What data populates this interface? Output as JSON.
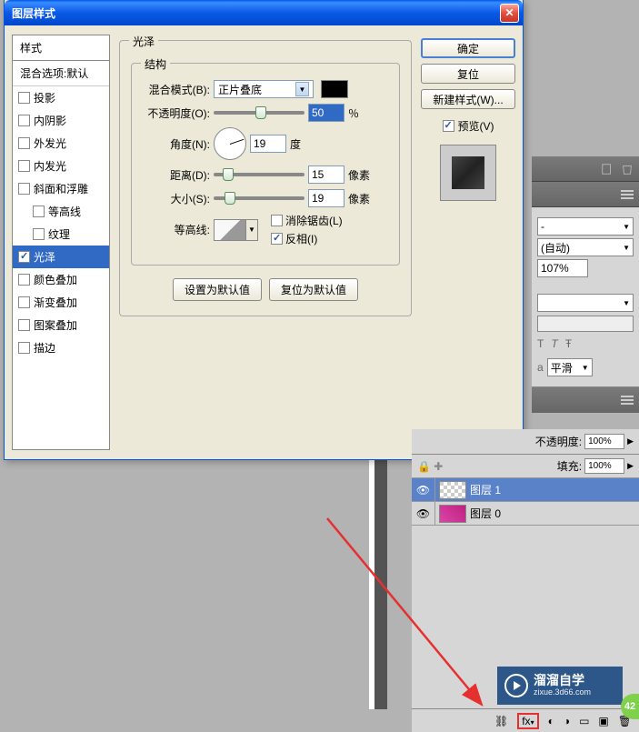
{
  "dialog": {
    "title": "图层样式",
    "styles_header": "样式",
    "blending_options": "混合选项:默认",
    "style_items": [
      {
        "label": "投影",
        "checked": false,
        "indent": false
      },
      {
        "label": "内阴影",
        "checked": false,
        "indent": false
      },
      {
        "label": "外发光",
        "checked": false,
        "indent": false
      },
      {
        "label": "内发光",
        "checked": false,
        "indent": false
      },
      {
        "label": "斜面和浮雕",
        "checked": false,
        "indent": false
      },
      {
        "label": "等高线",
        "checked": false,
        "indent": true
      },
      {
        "label": "纹理",
        "checked": false,
        "indent": true
      },
      {
        "label": "光泽",
        "checked": true,
        "indent": false,
        "selected": true
      },
      {
        "label": "颜色叠加",
        "checked": false,
        "indent": false
      },
      {
        "label": "渐变叠加",
        "checked": false,
        "indent": false
      },
      {
        "label": "图案叠加",
        "checked": false,
        "indent": false
      },
      {
        "label": "描边",
        "checked": false,
        "indent": false
      }
    ],
    "satin": {
      "title": "光泽",
      "structure_title": "结构",
      "blend_mode_label": "混合模式(B):",
      "blend_mode_value": "正片叠底",
      "opacity_label": "不透明度(O):",
      "opacity_value": "50",
      "opacity_unit": "％",
      "angle_label": "角度(N):",
      "angle_value": "19",
      "angle_unit": "度",
      "distance_label": "距离(D):",
      "distance_value": "15",
      "distance_unit": "像素",
      "size_label": "大小(S):",
      "size_value": "19",
      "size_unit": "像素",
      "contour_label": "等高线:",
      "antialias_label": "消除锯齿(L)",
      "invert_label": "反相(I)",
      "invert_checked": true,
      "set_default": "设置为默认值",
      "reset_default": "复位为默认值"
    },
    "actions": {
      "ok": "确定",
      "reset": "复位",
      "new_style": "新建样式(W)...",
      "preview": "预览(V)",
      "preview_checked": true
    }
  },
  "right_panel": {
    "dash": "-",
    "auto": "(自动)",
    "pct107": "107%",
    "smooth_label": "平滑"
  },
  "layers": {
    "opacity_label": "不透明度:",
    "opacity_value": "100%",
    "fill_label": "填充:",
    "fill_value": "100%",
    "layer1": "图层 1",
    "layer0": "图层 0",
    "fx": "fx"
  },
  "watermark": {
    "main": "溜溜自学",
    "sub": "zixue.3d66.com"
  },
  "badge": "42"
}
